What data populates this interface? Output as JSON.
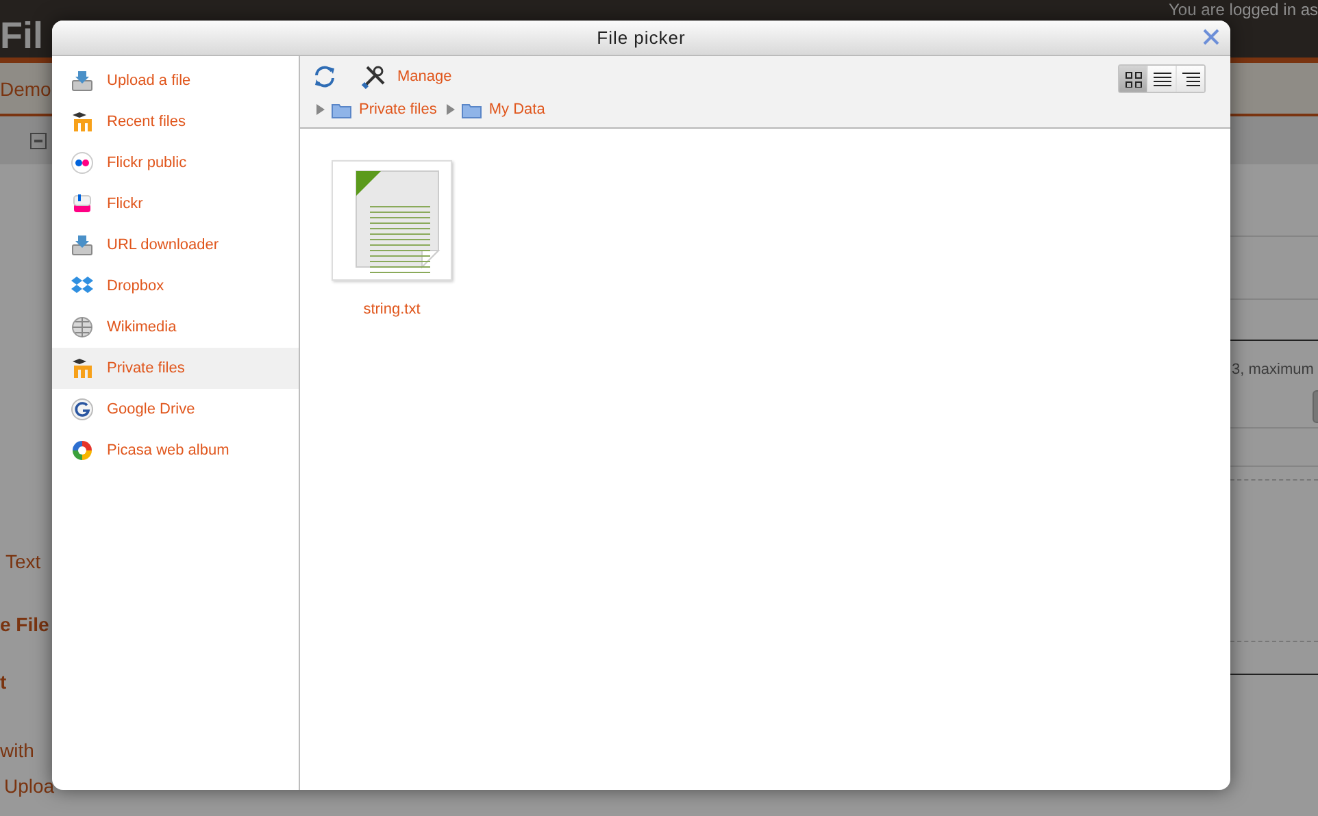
{
  "page": {
    "header_title": "Fil",
    "user_note": "You are logged in as",
    "nav_item": "Demo",
    "side_texts": [
      {
        "text": "Text",
        "kind": "plain"
      },
      {
        "text": "e File",
        "kind": "bold"
      },
      {
        "text": "t",
        "kind": "bold"
      },
      {
        "text": "with",
        "kind": "plain"
      },
      {
        "text": "Uploa",
        "kind": "plain"
      }
    ],
    "right_note": "3, maximum"
  },
  "dialog": {
    "title": "File picker",
    "sources": [
      {
        "label": "Upload a file",
        "selected": false
      },
      {
        "label": "Recent files",
        "selected": false
      },
      {
        "label": "Flickr public",
        "selected": false
      },
      {
        "label": "Flickr",
        "selected": false
      },
      {
        "label": "URL downloader",
        "selected": false
      },
      {
        "label": "Dropbox",
        "selected": false
      },
      {
        "label": "Wikimedia",
        "selected": false
      },
      {
        "label": "Private files",
        "selected": true
      },
      {
        "label": "Google Drive",
        "selected": false
      },
      {
        "label": "Picasa web album",
        "selected": false
      }
    ],
    "manage": "Manage",
    "view_modes": [
      {
        "kind": "icons",
        "selected": true
      },
      {
        "kind": "list",
        "selected": false
      },
      {
        "kind": "tree",
        "selected": false
      }
    ],
    "breadcrumb": [
      "Private files",
      "My Data"
    ],
    "files": [
      {
        "name": "string.txt"
      }
    ]
  }
}
